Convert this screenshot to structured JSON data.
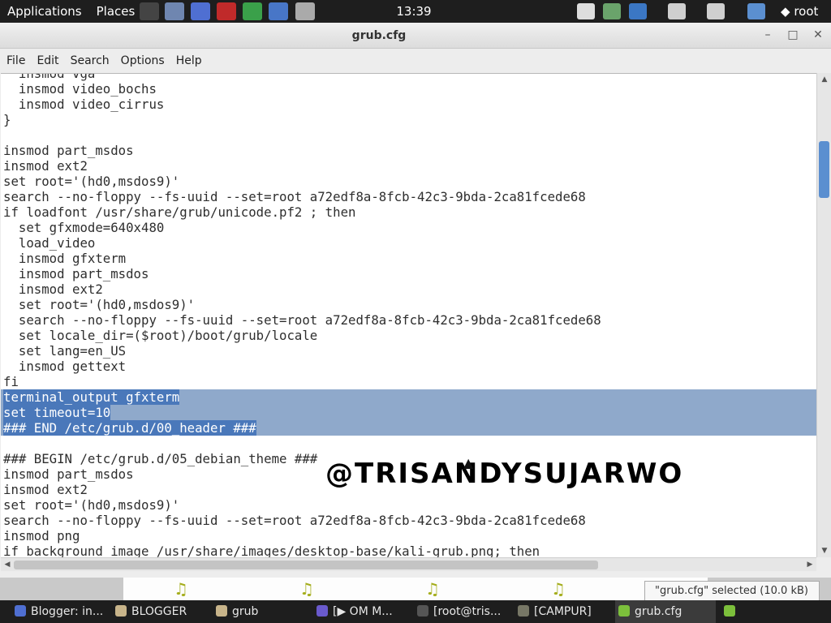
{
  "top_panel": {
    "menus": [
      "Applications",
      "Places"
    ],
    "launchers": [
      {
        "icon": "terminal-icon",
        "color": "#444444"
      },
      {
        "icon": "tools-icon",
        "color": "#6f86b0"
      },
      {
        "icon": "iceweasel-icon",
        "color": "#4f6fd2"
      },
      {
        "icon": "burp-icon",
        "color": "#c02a2a"
      },
      {
        "icon": "chrome-icon",
        "color": "#3aa04a"
      },
      {
        "icon": "network-icon",
        "color": "#4876c7"
      },
      {
        "icon": "kali-tool-icon",
        "color": "#aaaaaa"
      }
    ],
    "clock": "13:39",
    "tray": [
      {
        "icon": "device-icon",
        "color": "#dddddd"
      },
      {
        "icon": "chat-icon",
        "color": "#6aa36b"
      },
      {
        "icon": "document-icon",
        "color": "#3b77c4"
      },
      {
        "icon": "volume-icon",
        "color": "#cfcfcf"
      },
      {
        "icon": "clipboard-icon",
        "color": "#cfcfcf"
      },
      {
        "icon": "signal-icon",
        "color": "#5b8fd0"
      }
    ],
    "user": "root"
  },
  "window": {
    "title": "grub.cfg",
    "controls": {
      "minimize": "–",
      "maximize": "□",
      "close": "✕"
    }
  },
  "menubar": [
    "File",
    "Edit",
    "Search",
    "Options",
    "Help"
  ],
  "editor": {
    "lines": [
      {
        "text": "  insmod vga",
        "selected": false
      },
      {
        "text": "  insmod video_bochs",
        "selected": false
      },
      {
        "text": "  insmod video_cirrus",
        "selected": false
      },
      {
        "text": "}",
        "selected": false
      },
      {
        "text": "",
        "selected": false
      },
      {
        "text": "insmod part_msdos",
        "selected": false
      },
      {
        "text": "insmod ext2",
        "selected": false
      },
      {
        "text": "set root='(hd0,msdos9)'",
        "selected": false
      },
      {
        "text": "search --no-floppy --fs-uuid --set=root a72edf8a-8fcb-42c3-9bda-2ca81fcede68",
        "selected": false
      },
      {
        "text": "if loadfont /usr/share/grub/unicode.pf2 ; then",
        "selected": false
      },
      {
        "text": "  set gfxmode=640x480",
        "selected": false
      },
      {
        "text": "  load_video",
        "selected": false
      },
      {
        "text": "  insmod gfxterm",
        "selected": false
      },
      {
        "text": "  insmod part_msdos",
        "selected": false
      },
      {
        "text": "  insmod ext2",
        "selected": false
      },
      {
        "text": "  set root='(hd0,msdos9)'",
        "selected": false
      },
      {
        "text": "  search --no-floppy --fs-uuid --set=root a72edf8a-8fcb-42c3-9bda-2ca81fcede68",
        "selected": false
      },
      {
        "text": "  set locale_dir=($root)/boot/grub/locale",
        "selected": false
      },
      {
        "text": "  set lang=en_US",
        "selected": false
      },
      {
        "text": "  insmod gettext",
        "selected": false
      },
      {
        "text": "fi",
        "selected": false
      },
      {
        "text": "terminal_output gfxterm",
        "selected": true
      },
      {
        "text": "set timeout=10",
        "selected": true
      },
      {
        "text": "### END /etc/grub.d/00_header ###",
        "selected": true
      },
      {
        "text": "",
        "selected": false
      },
      {
        "text": "### BEGIN /etc/grub.d/05_debian_theme ###",
        "selected": false
      },
      {
        "text": "insmod part_msdos",
        "selected": false
      },
      {
        "text": "insmod ext2",
        "selected": false
      },
      {
        "text": "set root='(hd0,msdos9)'",
        "selected": false
      },
      {
        "text": "search --no-floppy --fs-uuid --set=root a72edf8a-8fcb-42c3-9bda-2ca81fcede68",
        "selected": false
      },
      {
        "text": "insmod png",
        "selected": false
      },
      {
        "text": "if background_image /usr/share/images/desktop-base/kali-grub.png; then",
        "selected": false
      }
    ],
    "watermark": "@TRISANDYSUJARWO",
    "selection_color": "#4a78ba"
  },
  "status_popup": "\"grub.cfg\" selected (10.0 kB)",
  "taskbar": [
    {
      "label": "Blogger: in...",
      "icon": "blogger-icon",
      "color": "#4f6fd2",
      "active": false
    },
    {
      "label": "BLOGGER",
      "icon": "folder-icon",
      "color": "#c8b48a",
      "active": false
    },
    {
      "label": "grub",
      "icon": "folder-icon",
      "color": "#c8b48a",
      "active": false
    },
    {
      "label": "[▶ OM M...",
      "icon": "media-icon",
      "color": "#6a5acd",
      "active": false
    },
    {
      "label": "[root@tris...",
      "icon": "terminal-icon",
      "color": "#555555",
      "active": false
    },
    {
      "label": "[CAMPUR]",
      "icon": "image-icon",
      "color": "#777766",
      "active": false
    },
    {
      "label": "grub.cfg",
      "icon": "editor-icon",
      "color": "#7cbf3b",
      "active": true
    },
    {
      "label": "",
      "icon": "leaf-icon",
      "color": "#7cbf3b",
      "active": false
    }
  ]
}
